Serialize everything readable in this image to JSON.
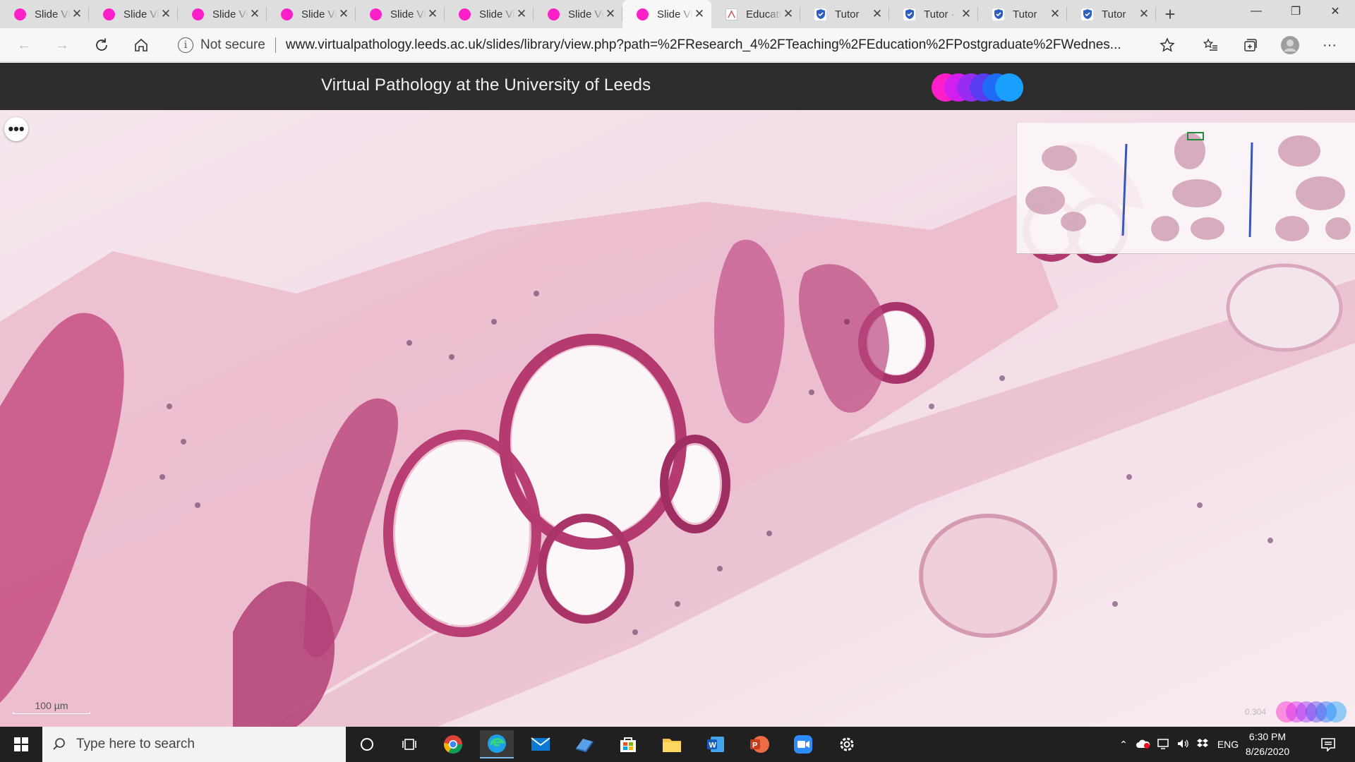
{
  "browser": {
    "tabs": [
      {
        "title": "Slide Viewer",
        "favicon": "pink-dot",
        "active": false
      },
      {
        "title": "Slide Viewer",
        "favicon": "pink-dot",
        "active": false
      },
      {
        "title": "Slide Viewer",
        "favicon": "pink-dot",
        "active": false
      },
      {
        "title": "Slide Viewer",
        "favicon": "pink-dot",
        "active": false
      },
      {
        "title": "Slide Viewer",
        "favicon": "pink-dot",
        "active": false
      },
      {
        "title": "Slide Viewer",
        "favicon": "pink-dot",
        "active": false
      },
      {
        "title": "Slide Viewer",
        "favicon": "pink-dot",
        "active": false
      },
      {
        "title": "Slide Viewer",
        "favicon": "pink-dot",
        "active": true
      },
      {
        "title": "Educati",
        "favicon": "document",
        "active": false
      },
      {
        "title": "Tutor",
        "favicon": "shield",
        "active": false
      },
      {
        "title": "Tutor ·",
        "favicon": "shield",
        "active": false
      },
      {
        "title": "Tutor",
        "favicon": "shield",
        "active": false
      },
      {
        "title": "Tutor",
        "favicon": "shield",
        "active": false
      }
    ],
    "address": {
      "security_label": "Not secure",
      "url": "www.virtualpathology.leeds.ac.uk/slides/library/view.php?path=%2FResearch_4%2FTeaching%2FEducation%2FPostgraduate%2FWednes..."
    }
  },
  "page": {
    "title": "Virtual Pathology at the University of Leeds",
    "logo_colors": [
      "#ff1fc8",
      "#d21ff0",
      "#9a2cf2",
      "#5a3cf0",
      "#1e6cf5",
      "#1aa0ff"
    ]
  },
  "viewer": {
    "scale_label": "100 µm",
    "zoom_label": "0.304"
  },
  "taskbar": {
    "search_placeholder": "Type here to search",
    "tray_language": "ENG",
    "time": "6:30 PM",
    "date": "8/26/2020"
  },
  "colors": {
    "tab_strip": "#dedede",
    "header_bg": "#2d2d2d",
    "taskbar_bg": "#202020",
    "tissue_pink": "#c24a7d",
    "stroma_pink": "#f1cfdc"
  }
}
